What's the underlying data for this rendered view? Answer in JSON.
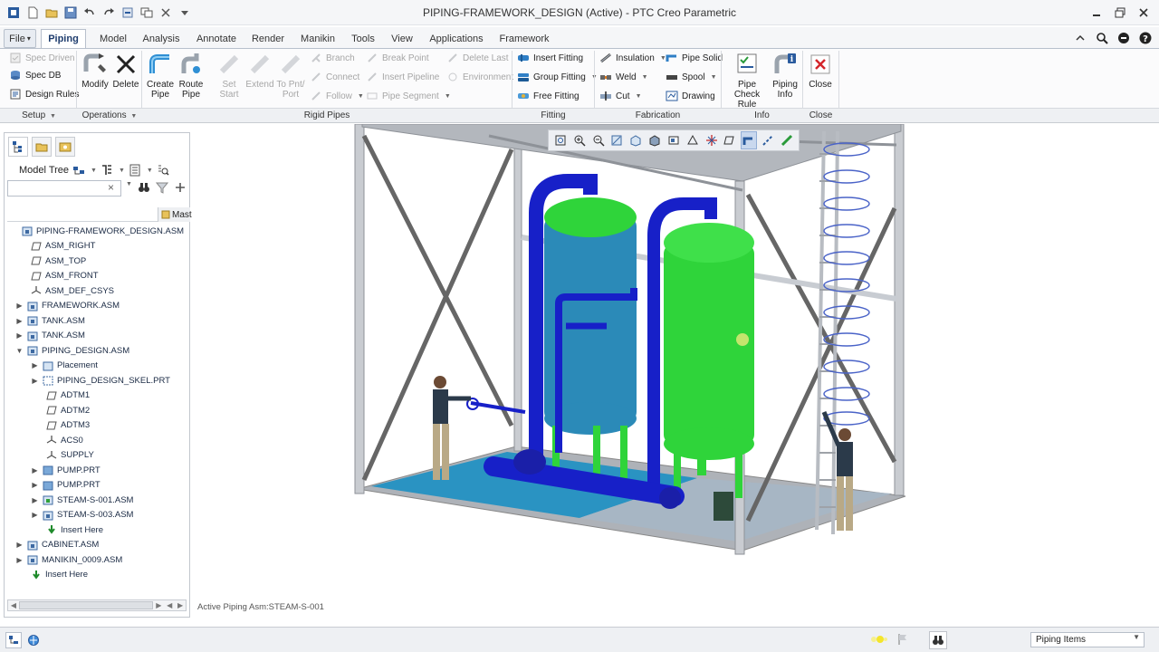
{
  "window": {
    "title": "PIPING-FRAMEWORK_DESIGN (Active) - PTC Creo Parametric"
  },
  "tabs": [
    {
      "label": "File",
      "caret": "▾"
    },
    {
      "label": "Piping"
    },
    {
      "label": "Model"
    },
    {
      "label": "Analysis"
    },
    {
      "label": "Annotate"
    },
    {
      "label": "Render"
    },
    {
      "label": "Manikin"
    },
    {
      "label": "Tools"
    },
    {
      "label": "View"
    },
    {
      "label": "Applications"
    },
    {
      "label": "Framework"
    }
  ],
  "ribbon": {
    "setup": {
      "spec_driven": "Spec Driven",
      "spec_db": "Spec DB",
      "design_rules": "Design Rules",
      "group": "Setup"
    },
    "operations": {
      "modify": "Modify",
      "delete": "Delete",
      "group": "Operations"
    },
    "rigid_pipes": {
      "create_pipe": [
        "Create",
        "Pipe"
      ],
      "route_pipe": [
        "Route",
        "Pipe"
      ],
      "set_start": [
        "Set",
        "Start"
      ],
      "extend": "Extend",
      "to_pnt_port": [
        "To Pnt/",
        "Port"
      ],
      "branch": "Branch",
      "connect": "Connect",
      "follow": "Follow",
      "break_point": "Break Point",
      "insert_pipeline": "Insert Pipeline",
      "pipe_segment": "Pipe Segment",
      "delete_last": "Delete Last",
      "environment": "Environment",
      "group": "Rigid Pipes"
    },
    "fitting": {
      "insert_fitting": "Insert Fitting",
      "group_fitting": "Group Fitting",
      "free_fitting": "Free Fitting",
      "group": "Fitting"
    },
    "fabrication": {
      "insulation": "Insulation",
      "weld": "Weld",
      "cut": "Cut",
      "pipe_solid": "Pipe Solid",
      "spool": "Spool",
      "drawing": "Drawing",
      "group": "Fabrication"
    },
    "info": {
      "pipe_check_rule": [
        "Pipe Check",
        "Rule"
      ],
      "piping_info": [
        "Piping",
        "Info"
      ],
      "group": "Info"
    },
    "close": {
      "close": "Close",
      "group": "Close"
    }
  },
  "model_tree": {
    "label": "Model Tree",
    "column_header": "Mast",
    "search_value": "",
    "nodes": [
      {
        "label": "PIPING-FRAMEWORK_DESIGN.ASM",
        "icon": "assembly-icon"
      },
      {
        "label": "ASM_RIGHT",
        "icon": "datum-plane-icon"
      },
      {
        "label": "ASM_TOP",
        "icon": "datum-plane-icon"
      },
      {
        "label": "ASM_FRONT",
        "icon": "datum-plane-icon"
      },
      {
        "label": "ASM_DEF_CSYS",
        "icon": "csys-icon"
      },
      {
        "label": "FRAMEWORK.ASM",
        "icon": "assembly-icon"
      },
      {
        "label": "TANK.ASM",
        "icon": "assembly-icon"
      },
      {
        "label": "TANK.ASM",
        "icon": "assembly-icon"
      },
      {
        "label": "PIPING_DESIGN.ASM",
        "icon": "assembly-icon"
      },
      {
        "label": "Placement",
        "icon": "placement-icon"
      },
      {
        "label": "PIPING_DESIGN_SKEL.PRT",
        "icon": "skeleton-icon"
      },
      {
        "label": "ADTM1",
        "icon": "datum-plane-icon"
      },
      {
        "label": "ADTM2",
        "icon": "datum-plane-icon"
      },
      {
        "label": "ADTM3",
        "icon": "datum-plane-icon"
      },
      {
        "label": "ACS0",
        "icon": "csys-icon"
      },
      {
        "label": "SUPPLY",
        "icon": "csys-icon"
      },
      {
        "label": "PUMP.PRT",
        "icon": "part-icon"
      },
      {
        "label": "PUMP.PRT",
        "icon": "part-icon"
      },
      {
        "label": "STEAM-S-001.ASM",
        "icon": "assembly-icon"
      },
      {
        "label": "STEAM-S-003.ASM",
        "icon": "assembly-icon"
      },
      {
        "label": "Insert Here",
        "icon": "insert-arrow-icon"
      },
      {
        "label": "CABINET.ASM",
        "icon": "assembly-icon"
      },
      {
        "label": "MANIKIN_0009.ASM",
        "icon": "assembly-icon"
      },
      {
        "label": "Insert Here",
        "icon": "insert-arrow-icon"
      }
    ]
  },
  "graphics": {
    "active_status": "Active Piping Asm:STEAM-S-001",
    "colors": {
      "tank_blue": "#2b8ab8",
      "tank_green": "#2fd43a",
      "pipe_blue": "#1720c8",
      "floor": "#2a93c2",
      "frame": "#b8bcc2"
    }
  },
  "statusbar": {
    "filter_value": "Piping Items"
  }
}
